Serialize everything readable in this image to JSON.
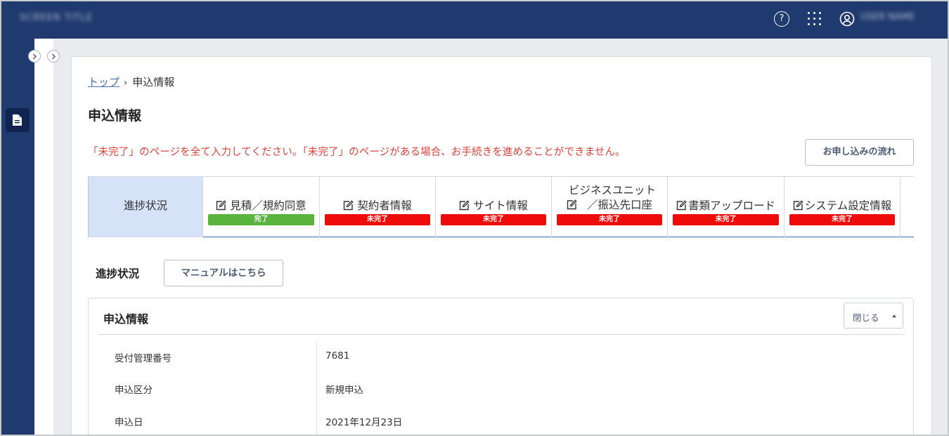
{
  "header": {
    "app_title": "SCREEN TITLE",
    "help_icon": "help-circle-icon",
    "apps_icon": "grid-apps-icon",
    "user_icon": "user-circle-icon",
    "user_name": "USER NAME"
  },
  "sidebar": {
    "doc_icon": "document-icon",
    "expand_icon": "chevron-right-icon"
  },
  "breadcrumb": {
    "top_link": "トップ",
    "separator": "›",
    "current": "申込情報"
  },
  "page": {
    "title": "申込情報",
    "warning": "「未完了」のページを全て入力してください。「未完了」のページがある場合、お手続きを進めることができません。",
    "flow_button": "お申し込みの流れ"
  },
  "tabs": [
    {
      "label": "進捗状況",
      "status": ""
    },
    {
      "label": "見積／規約同意",
      "status": "完了"
    },
    {
      "label": "契約者情報",
      "status": "未完了"
    },
    {
      "label": "サイト情報",
      "status": "未完了"
    },
    {
      "label_line1": "ビジネスユニット",
      "label_line2": "／振込先口座",
      "status": "未完了"
    },
    {
      "label": "書類アップロード",
      "status": "未完了"
    },
    {
      "label": "システム設定情報",
      "status": "未完了"
    }
  ],
  "progress": {
    "title": "進捗状況",
    "manual_button": "マニュアルはこちら"
  },
  "info": {
    "title": "申込情報",
    "close_button": "閉じる",
    "rows": [
      {
        "key": "受付管理番号",
        "value": "7681"
      },
      {
        "key": "申込区分",
        "value": "新規申込"
      },
      {
        "key": "申込日",
        "value": "2021年12月23日"
      }
    ]
  },
  "colors": {
    "header_bg": "#1f3a6e",
    "active_tab_bg": "#d5e2f7",
    "done_badge": "#5ab33d",
    "todo_badge": "#f00b0b",
    "warning_text": "#d9443a",
    "link": "#4a6fae"
  }
}
